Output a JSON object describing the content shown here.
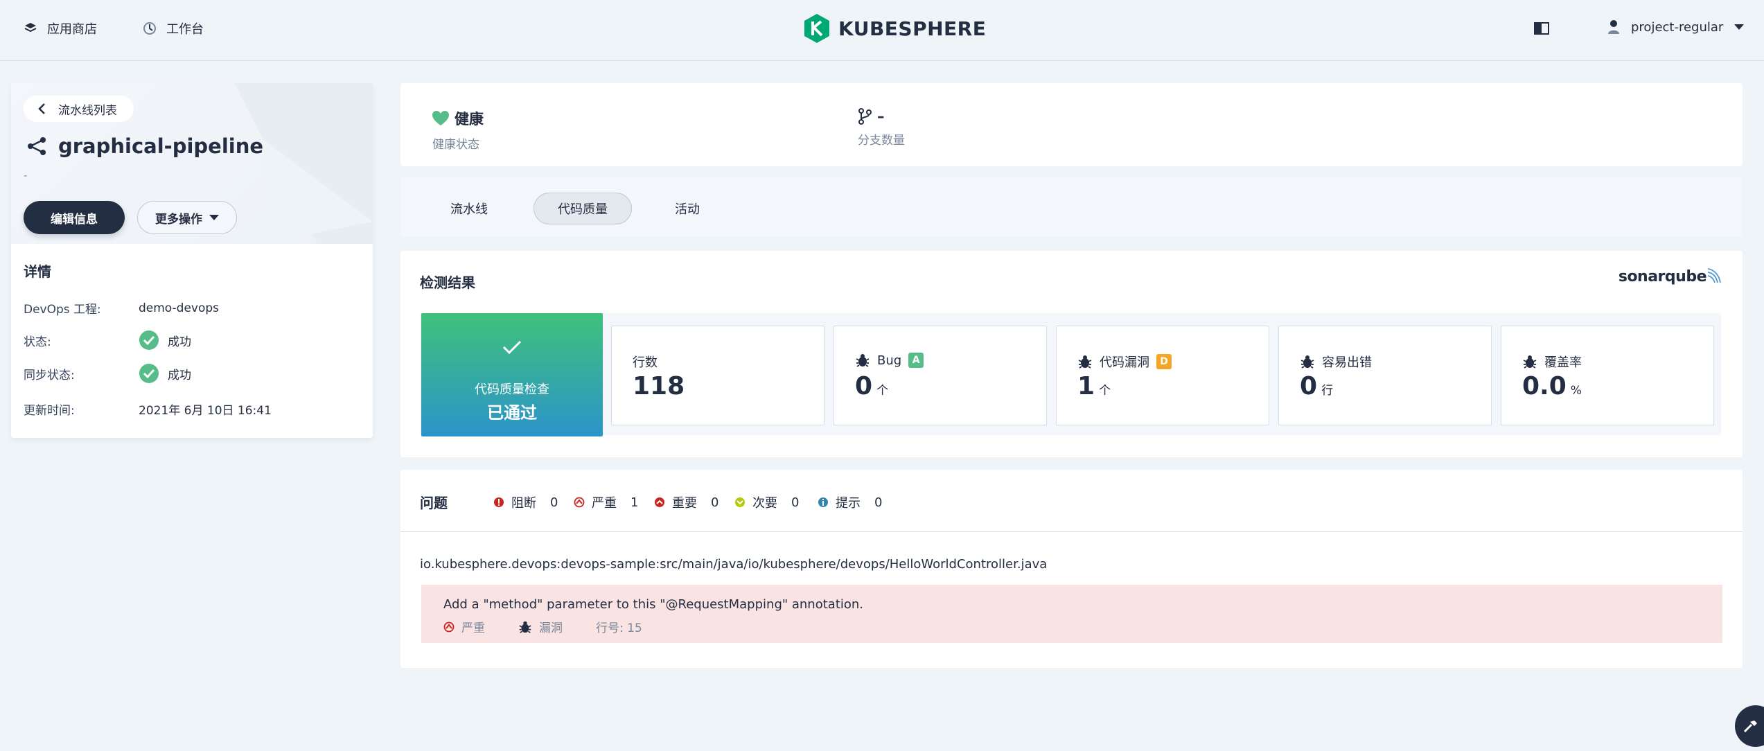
{
  "header": {
    "nav": [
      {
        "label": "应用商店",
        "icon": "app-store-icon"
      },
      {
        "label": "工作台",
        "icon": "workbench-icon"
      }
    ],
    "logo_text": "KUBESPHERE",
    "username": "project-regular"
  },
  "sidebar": {
    "back_label": "流水线列表",
    "pipeline_name": "graphical-pipeline",
    "description": "-",
    "edit_button": "编辑信息",
    "more_button": "更多操作",
    "details_title": "详情",
    "details": [
      {
        "key": "DevOps 工程:",
        "value": "demo-devops"
      },
      {
        "key": "状态:",
        "value": "成功"
      },
      {
        "key": "同步状态:",
        "value": "成功"
      },
      {
        "key": "更新时间:",
        "value": "2021年 6月 10日 16:41"
      }
    ]
  },
  "summary": {
    "health_value": "健康",
    "health_label": "健康状态",
    "branch_value": "–",
    "branch_label": "分支数量"
  },
  "tabs": [
    "流水线",
    "代码质量",
    "活动"
  ],
  "active_tab": "代码质量",
  "result": {
    "title": "检测结果",
    "brand": "sonarqube",
    "gate_label": "代码质量检查",
    "gate_status": "已通过",
    "metrics": [
      {
        "label": "行数",
        "value": "118",
        "unit": "",
        "badge": ""
      },
      {
        "label": "Bug",
        "value": "0",
        "unit": "个",
        "badge": "A"
      },
      {
        "label": "代码漏洞",
        "value": "1",
        "unit": "个",
        "badge": "D"
      },
      {
        "label": "容易出错",
        "value": "0",
        "unit": "行",
        "badge": ""
      },
      {
        "label": "覆盖率",
        "value": "0.0",
        "unit": "%",
        "badge": ""
      }
    ],
    "colors": {
      "badge_a": "#55bc8a",
      "badge_d": "#f5a623",
      "passed_top": "#3fc17c",
      "passed_bottom": "#2c94c9"
    }
  },
  "issues": {
    "title": "问题",
    "severities": [
      {
        "label": "阻断",
        "count": "0",
        "color": "#ca2621"
      },
      {
        "label": "严重",
        "count": "1",
        "color": "#ca2621"
      },
      {
        "label": "重要",
        "count": "0",
        "color": "#ca2621"
      },
      {
        "label": "次要",
        "count": "0",
        "color": "#b7c90a"
      },
      {
        "label": "提示",
        "count": "0",
        "color": "#3385b0"
      }
    ],
    "file": "io.kubesphere.devops:devops-sample:src/main/java/io/kubesphere/devops/HelloWorldController.java",
    "item": {
      "message": "Add a \"method\" parameter to this \"@RequestMapping\" annotation.",
      "severity": "严重",
      "type": "漏洞",
      "line": "行号: 15"
    }
  }
}
